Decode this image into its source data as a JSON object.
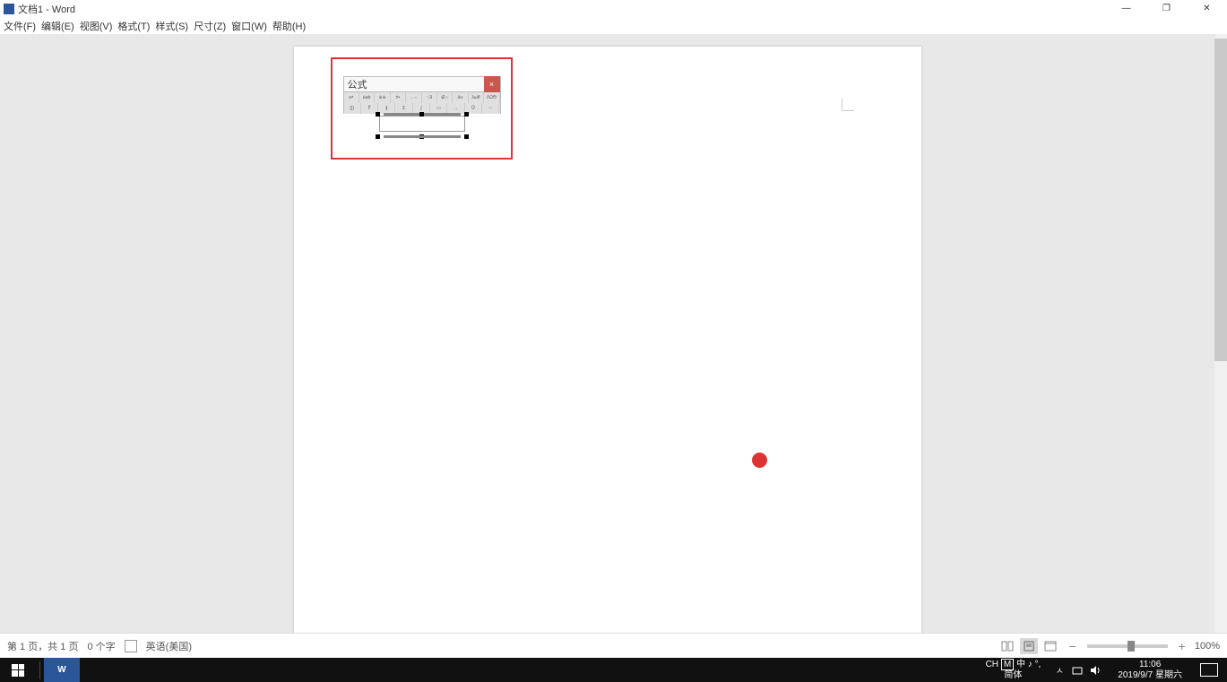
{
  "titlebar": {
    "document_name": "文档1",
    "app_name": "Word",
    "separator": " - "
  },
  "window_controls": {
    "minimize": "—",
    "maximize": "❐",
    "close": "✕"
  },
  "menubar": {
    "file": "文件(F)",
    "edit": "编辑(E)",
    "view": "视图(V)",
    "format": "格式(T)",
    "style": "样式(S)",
    "size": "尺寸(Z)",
    "window": "窗口(W)",
    "help": "帮助(H)"
  },
  "formula_editor": {
    "title": "公式",
    "close": "×"
  },
  "statusbar": {
    "page_info": "第 1 页，共 1 页",
    "word_count": "0 个字",
    "language": "英语(美国)",
    "zoom_minus": "−",
    "zoom_plus": "+",
    "zoom_level": "100%"
  },
  "taskbar": {
    "word_label": "W",
    "ime_lang": "CH",
    "ime_mode": "M",
    "ime_state": "中 ♪ °,",
    "ime_sub": "简体",
    "tray_up": "ㅅ",
    "time": "11:06",
    "date": "2019/9/7 星期六"
  }
}
